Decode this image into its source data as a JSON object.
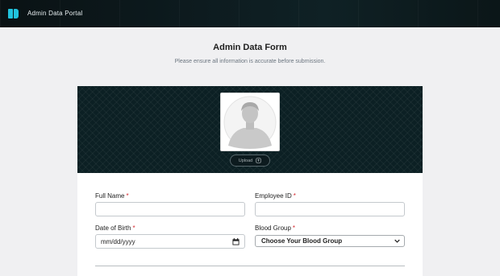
{
  "header": {
    "app_title": "Admin Data Portal"
  },
  "page": {
    "title": "Admin Data Form",
    "subtitle": "Please ensure all information is accurate before submission."
  },
  "profile": {
    "upload_label": "Upload"
  },
  "form": {
    "full_name": {
      "label": "Full Name",
      "required": "*",
      "value": ""
    },
    "employee_id": {
      "label": "Employee ID",
      "required": "*",
      "value": ""
    },
    "dob": {
      "label": "Date of Birth",
      "required": "*",
      "placeholder": "mm/dd/yyyy"
    },
    "blood_group": {
      "label": "Blood Group",
      "required": "*",
      "selected": "Choose Your Blood Group"
    }
  },
  "colors": {
    "accent": "#21c3dd",
    "required": "#d4282e",
    "header_bg": "#0d1b1f"
  },
  "icons": {
    "logo": "brand-logo-icon",
    "upload": "upload-icon",
    "calendar": "calendar-icon",
    "dropdown": "chevron-down-icon",
    "avatar": "user-placeholder-icon"
  }
}
